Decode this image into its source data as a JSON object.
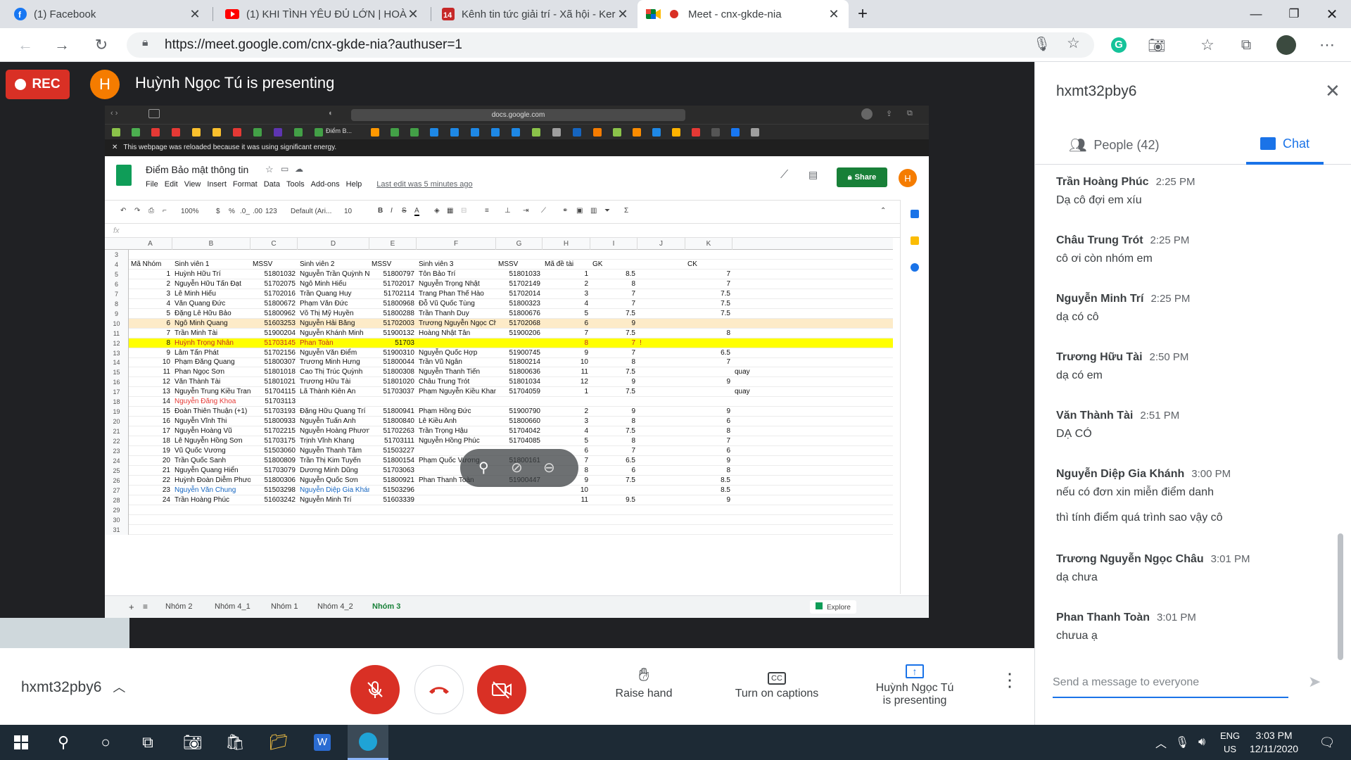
{
  "browser": {
    "tabs": [
      {
        "title": "(1) Facebook",
        "icon": "facebook-icon"
      },
      {
        "title": "(1) KHI TÌNH YÊU ĐỦ LỚN | HOÀ",
        "icon": "youtube-icon"
      },
      {
        "title": "Kênh tin tức giải trí - Xã hội - Ker",
        "icon": "news-icon"
      },
      {
        "title": "Meet - cnx-gkde-nia",
        "icon": "meet-icon"
      }
    ],
    "url": "https://meet.google.com/cnx-gkde-nia?authuser=1"
  },
  "meet": {
    "rec_label": "REC",
    "presenter_initial": "H",
    "presenting_title": "Huỳnh Ngọc Tú is presenting",
    "meeting_code": "hxmt32pby6",
    "actions": {
      "raise_hand": "Raise hand",
      "captions": "Turn on captions",
      "presenting_line1": "Huỳnh Ngọc Tú",
      "presenting_line2": "is presenting"
    }
  },
  "shared_screen": {
    "safari_url": "docs.google.com",
    "bookmark_label": "Điểm B...",
    "warning": "This webpage was reloaded because it was using significant energy.",
    "doc_title": "Điểm Bảo mật thông tin",
    "menus": [
      "File",
      "Edit",
      "View",
      "Insert",
      "Format",
      "Data",
      "Tools",
      "Add-ons",
      "Help"
    ],
    "last_edit": "Last edit was 5 minutes ago",
    "share_label": "Share",
    "avatar_initial": "H",
    "toolbar": {
      "zoom": "100%",
      "currency": "$",
      "percent": "%",
      "dec1": ".0_",
      "dec2": ".00",
      "format": "123",
      "font": "Default (Ari...",
      "size": "10"
    },
    "fx_label": "fx",
    "columns": [
      "A",
      "B",
      "C",
      "D",
      "E",
      "F",
      "G",
      "H",
      "I",
      "J",
      "K"
    ],
    "header_row": {
      "num": "4",
      "a": "Mã Nhóm",
      "b": "Sinh viên 1",
      "c": "MSSV",
      "d": "Sinh viên 2",
      "e": "MSSV",
      "f": "Sinh viên 3",
      "g": "MSSV",
      "h": "Mã đề tài",
      "i": "GK",
      "k": "CK"
    },
    "rows": [
      {
        "n": "5",
        "a": "1",
        "b": "Huỳnh Hữu Trí",
        "c": "51801032",
        "d": "Nguyễn Trần Quỳnh Như",
        "e": "51800797",
        "f": "Tôn Bảo Trí",
        "g": "51801033",
        "h": "1",
        "i": "8.5",
        "k": "7"
      },
      {
        "n": "6",
        "a": "2",
        "b": "Nguyễn Hữu Tấn Đạt",
        "c": "51702075",
        "d": "Ngô Minh Hiếu",
        "e": "51702017",
        "f": "Nguyễn Trọng Nhật",
        "g": "51702149",
        "h": "2",
        "i": "8",
        "k": "7"
      },
      {
        "n": "7",
        "a": "3",
        "b": "Lê Minh Hiếu",
        "c": "51702016",
        "d": "Trần Quang Huy",
        "e": "51702114",
        "f": "Trang Phan Thế Hào",
        "g": "51702014",
        "h": "3",
        "i": "7",
        "k": "7.5"
      },
      {
        "n": "8",
        "a": "4",
        "b": "Văn Quang Đức",
        "c": "51800672",
        "d": "Phạm Văn Đức",
        "e": "51800968",
        "f": "Đỗ Vũ Quốc Tùng",
        "g": "51800323",
        "h": "4",
        "i": "7",
        "k": "7.5"
      },
      {
        "n": "9",
        "a": "5",
        "b": "Đặng Lê Hữu Bảo",
        "c": "51800962",
        "d": "Võ Thị Mỹ Huyền",
        "e": "51800288",
        "f": "Trần Thanh Duy",
        "g": "51800676",
        "h": "5",
        "i": "7.5",
        "k": "7.5"
      },
      {
        "n": "10",
        "a": "6",
        "b": "Ngô Minh Quang",
        "c": "51603253",
        "d": "Nguyễn Hải Băng",
        "e": "51702003",
        "f": "Trương Nguyễn Ngọc Châu",
        "g": "51702068",
        "h": "6",
        "i": "9",
        "k": "",
        "hl": "orange"
      },
      {
        "n": "11",
        "a": "7",
        "b": "Trần Minh Tài",
        "c": "51900204",
        "d": "Nguyễn Khánh Minh",
        "e": "51900132",
        "f": "Hoàng Nhật Tân",
        "g": "51900206",
        "h": "7",
        "i": "7.5",
        "k": "8"
      },
      {
        "n": "12",
        "a": "8",
        "b": "Huỳnh Trọng Nhân",
        "c": "51703145",
        "d": "Phan Toàn",
        "e": "51703",
        "f": "",
        "g": "",
        "h": "8",
        "i": "7",
        "k": "",
        "hl": "yellow",
        "j": "!"
      },
      {
        "n": "13",
        "a": "9",
        "b": "Lâm Tấn Phát",
        "c": "51702156",
        "d": "Nguyễn Văn Điểm",
        "e": "51900310",
        "f": "Nguyễn Quốc Hợp",
        "g": "51900745",
        "h": "9",
        "i": "7",
        "k": "6.5"
      },
      {
        "n": "14",
        "a": "10",
        "b": "Phạm Đăng Quang",
        "c": "51800307",
        "d": "Trương Minh Hưng",
        "e": "51800044",
        "f": "Trần Vũ Ngân",
        "g": "51800214",
        "h": "10",
        "i": "8",
        "k": "7"
      },
      {
        "n": "15",
        "a": "11",
        "b": "Phan Ngọc Sơn",
        "c": "51801018",
        "d": "Cao Thị Trúc Quỳnh",
        "e": "51800308",
        "f": "Nguyễn Thanh Tiến",
        "g": "51800636",
        "h": "11",
        "i": "7.5",
        "k": "",
        "extra": "quay"
      },
      {
        "n": "16",
        "a": "12",
        "b": "Văn Thành Tài",
        "c": "51801021",
        "d": "Trương Hữu Tài",
        "e": "51801020",
        "f": "Châu Trung Trót",
        "g": "51801034",
        "h": "12",
        "i": "9",
        "k": "9"
      },
      {
        "n": "17",
        "a": "13",
        "b": "Nguyễn Trung Kiều Trang",
        "c": "51704115",
        "d": "Lã Thành Kiên An",
        "e": "51703037",
        "f": "Phạm Nguyễn Kiều Khanh",
        "g": "51704059",
        "h": "1",
        "i": "7.5",
        "k": "",
        "extra": "quay"
      },
      {
        "n": "18",
        "a": "14",
        "b": "Nguyễn Đăng Khoa",
        "c": "51703113",
        "d": "",
        "e": "",
        "f": "",
        "g": "",
        "h": "",
        "i": "",
        "k": "",
        "red": true
      },
      {
        "n": "19",
        "a": "15",
        "b": "Đoàn Thiên Thuận (+1)",
        "c": "51703193",
        "d": "Đặng Hữu Quang Trí",
        "e": "51800941",
        "f": "Phạm Hồng Đức",
        "g": "51900790",
        "h": "2",
        "i": "9",
        "k": "9"
      },
      {
        "n": "20",
        "a": "16",
        "b": "Nguyễn Vĩnh Thi",
        "c": "51800933",
        "d": "Nguyễn Tuấn Anh",
        "e": "51800840",
        "f": "Lê Kiều Anh",
        "g": "51800660",
        "h": "3",
        "i": "8",
        "k": "6"
      },
      {
        "n": "21",
        "a": "17",
        "b": "Nguyễn Hoàng Vũ",
        "c": "51702215",
        "d": "Nguyễn Hoàng Phương",
        "e": "51702263",
        "f": "Trần Trọng Hậu",
        "g": "51704042",
        "h": "4",
        "i": "7.5",
        "k": "8"
      },
      {
        "n": "22",
        "a": "18",
        "b": "Lê Nguyễn Hồng Sơn",
        "c": "51703175",
        "d": "Trịnh Vĩnh Khang",
        "e": "51703111",
        "f": "Nguyễn Hồng Phúc",
        "g": "51704085",
        "h": "5",
        "i": "8",
        "k": "7"
      },
      {
        "n": "23",
        "a": "19",
        "b": "Vũ Quốc Vương",
        "c": "51503060",
        "d": "Nguyễn Thanh Tâm",
        "e": "51503227",
        "f": "",
        "g": "",
        "h": "6",
        "i": "7",
        "k": "6"
      },
      {
        "n": "24",
        "a": "20",
        "b": "Trần Quốc Sanh",
        "c": "51800809",
        "d": "Trần Thị Kim Tuyến",
        "e": "51800154",
        "f": "Phạm Quốc Vương",
        "g": "51800161",
        "h": "7",
        "i": "6.5",
        "k": "9"
      },
      {
        "n": "25",
        "a": "21",
        "b": "Nguyễn Quang Hiển",
        "c": "51703079",
        "d": "Dương Minh Dũng",
        "e": "51703063",
        "f": "",
        "g": "",
        "h": "8",
        "i": "6",
        "k": "8"
      },
      {
        "n": "26",
        "a": "22",
        "b": "Huỳnh Đoàn Diễm Phương",
        "c": "51800306",
        "d": "Nguyễn Quốc Sơn",
        "e": "51800921",
        "f": "Phan Thanh Toàn",
        "g": "51900447",
        "h": "9",
        "i": "7.5",
        "k": "8.5"
      },
      {
        "n": "27",
        "a": "23",
        "b": "Nguyễn Văn Chung",
        "c": "51503298",
        "d": "Nguyễn Diệp Gia Khánh",
        "e": "51503296",
        "f": "",
        "g": "",
        "h": "10",
        "i": "",
        "k": "8.5",
        "blue": true
      },
      {
        "n": "28",
        "a": "24",
        "b": "Trần Hoàng Phúc",
        "c": "51603242",
        "d": "Nguyễn Minh Trí",
        "e": "51603339",
        "f": "",
        "g": "",
        "h": "11",
        "i": "9.5",
        "k": "9"
      },
      {
        "n": "29"
      },
      {
        "n": "30"
      },
      {
        "n": "31"
      }
    ],
    "top_rows": [
      "3"
    ],
    "sheet_tabs": [
      "Nhóm 2",
      "Nhóm 4_1",
      "Nhóm 1",
      "Nhóm 4_2",
      "Nhóm 3"
    ],
    "active_sheet": "Nhóm 3",
    "explore_label": "Explore"
  },
  "panel": {
    "title": "hxmt32pby6",
    "people_label": "People (42)",
    "chat_label": "Chat",
    "messages": [
      {
        "name": "Trần Hoàng Phúc",
        "time": "2:25 PM",
        "text": "Dạ cô đợi em xíu"
      },
      {
        "name": "Châu Trung Trót",
        "time": "2:25 PM",
        "text": "cô ơi còn nhóm em"
      },
      {
        "name": "Nguyễn Minh Trí",
        "time": "2:25 PM",
        "text": "dạ có cô"
      },
      {
        "name": "Trương Hữu Tài",
        "time": "2:50 PM",
        "text": "dạ có em"
      },
      {
        "name": "Văn Thành Tài",
        "time": "2:51 PM",
        "text": "DẠ CÓ"
      },
      {
        "name": "Nguyễn Diệp Gia Khánh",
        "time": "3:00 PM",
        "text": "nếu có đơn xin miễn điểm danh",
        "text2": "thì tính điểm quá trình sao vậy cô"
      },
      {
        "name": "Trương Nguyễn Ngọc Châu",
        "time": "3:01 PM",
        "text": "dạ chưa"
      },
      {
        "name": "Phan Thanh Toàn",
        "time": "3:01 PM",
        "text": "chưua ạ"
      }
    ],
    "input_placeholder": "Send a message to everyone"
  },
  "taskbar": {
    "lang1": "ENG",
    "lang2": "US",
    "time": "3:03 PM",
    "date": "12/11/2020"
  }
}
